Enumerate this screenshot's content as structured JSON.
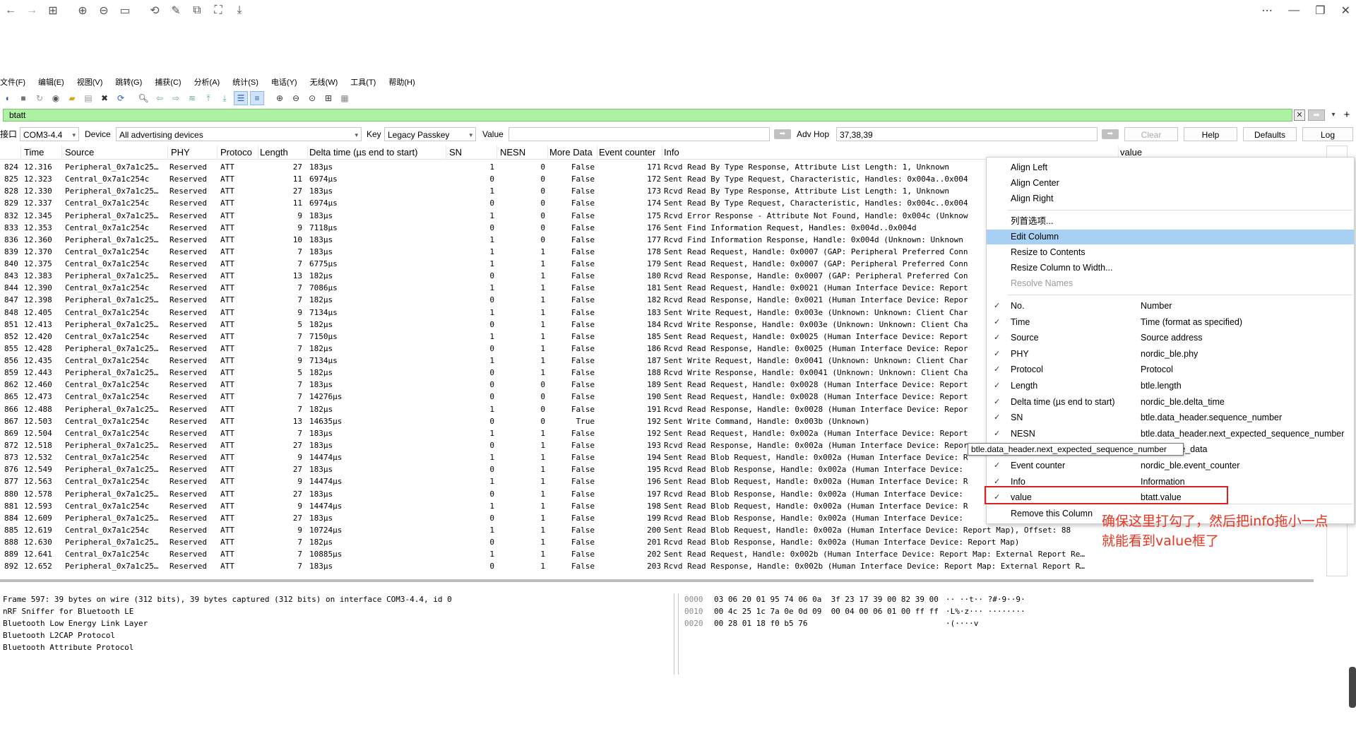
{
  "topbar": {
    "icons": [
      "back-icon",
      "forward-icon",
      "grid-icon",
      "zoom-in-icon",
      "zoom-out-icon",
      "fit-icon",
      "rotate-icon",
      "edit-icon",
      "copy-icon",
      "screenshot-icon",
      "save-icon"
    ],
    "window_controls": [
      "more-icon",
      "minimize-icon",
      "restore-icon",
      "close-icon"
    ]
  },
  "menubar": {
    "items": [
      "文件(F)",
      "编辑(E)",
      "视图(V)",
      "跳转(G)",
      "捕获(C)",
      "分析(A)",
      "统计(S)",
      "电话(Y)",
      "无线(W)",
      "工具(T)",
      "帮助(H)"
    ]
  },
  "filter": {
    "value": "btatt"
  },
  "sniffer": {
    "interface_label": "接口",
    "interface_value": "COM3-4.4",
    "device_label": "Device",
    "device_value": "All advertising devices",
    "key_label": "Key",
    "key_value": "Legacy Passkey",
    "value_label": "Value",
    "value_value": "",
    "advhop_label": "Adv Hop",
    "advhop_value": "37,38,39",
    "clear_label": "Clear",
    "help_label": "Help",
    "defaults_label": "Defaults",
    "log_label": "Log"
  },
  "packet_list": {
    "headers": {
      "time": "Time",
      "source": "Source",
      "phy": "PHY",
      "protocol": "Protoco",
      "length": "Length",
      "delta": "Delta time (µs end to start)",
      "sn": "SN",
      "nesn": "NESN",
      "more": "More Data",
      "event": "Event counter",
      "info": "Info",
      "value": "value"
    },
    "rows": [
      {
        "no": "824",
        "time": "12.316",
        "source": "Peripheral_0x7a1c25…",
        "phy": "Reserved",
        "proto": "ATT",
        "len": "27",
        "delta": "183µs",
        "sn": "1",
        "nesn": "0",
        "more": "False",
        "ev": "171",
        "info": "Rcvd Read By Type Response, Attribute List Length: 1, Unknown"
      },
      {
        "no": "825",
        "time": "12.323",
        "source": "Central_0x7a1c254c",
        "phy": "Reserved",
        "proto": "ATT",
        "len": "11",
        "delta": "6974µs",
        "sn": "0",
        "nesn": "0",
        "more": "False",
        "ev": "172",
        "info": "Sent Read By Type Request, Characteristic, Handles: 0x004a..0x004"
      },
      {
        "no": "828",
        "time": "12.330",
        "source": "Peripheral_0x7a1c25…",
        "phy": "Reserved",
        "proto": "ATT",
        "len": "27",
        "delta": "183µs",
        "sn": "1",
        "nesn": "0",
        "more": "False",
        "ev": "173",
        "info": "Rcvd Read By Type Response, Attribute List Length: 1, Unknown"
      },
      {
        "no": "829",
        "time": "12.337",
        "source": "Central_0x7a1c254c",
        "phy": "Reserved",
        "proto": "ATT",
        "len": "11",
        "delta": "6974µs",
        "sn": "0",
        "nesn": "0",
        "more": "False",
        "ev": "174",
        "info": "Sent Read By Type Request, Characteristic, Handles: 0x004c..0x004"
      },
      {
        "no": "832",
        "time": "12.345",
        "source": "Peripheral_0x7a1c25…",
        "phy": "Reserved",
        "proto": "ATT",
        "len": "9",
        "delta": "183µs",
        "sn": "1",
        "nesn": "0",
        "more": "False",
        "ev": "175",
        "info": "Rcvd Error Response - Attribute Not Found, Handle: 0x004c (Unknow"
      },
      {
        "no": "833",
        "time": "12.353",
        "source": "Central_0x7a1c254c",
        "phy": "Reserved",
        "proto": "ATT",
        "len": "9",
        "delta": "7118µs",
        "sn": "0",
        "nesn": "0",
        "more": "False",
        "ev": "176",
        "info": "Sent Find Information Request, Handles: 0x004d..0x004d"
      },
      {
        "no": "836",
        "time": "12.360",
        "source": "Peripheral_0x7a1c25…",
        "phy": "Reserved",
        "proto": "ATT",
        "len": "10",
        "delta": "183µs",
        "sn": "1",
        "nesn": "0",
        "more": "False",
        "ev": "177",
        "info": "Rcvd Find Information Response, Handle: 0x004d (Unknown: Unknown"
      },
      {
        "no": "839",
        "time": "12.370",
        "source": "Central_0x7a1c254c",
        "phy": "Reserved",
        "proto": "ATT",
        "len": "7",
        "delta": "183µs",
        "sn": "1",
        "nesn": "1",
        "more": "False",
        "ev": "178",
        "info": "Sent Read Request, Handle: 0x0007 (GAP: Peripheral Preferred Conn"
      },
      {
        "no": "840",
        "time": "12.375",
        "source": "Central_0x7a1c254c",
        "phy": "Reserved",
        "proto": "ATT",
        "len": "7",
        "delta": "6775µs",
        "sn": "1",
        "nesn": "1",
        "more": "False",
        "ev": "179",
        "info": "Sent Read Request, Handle: 0x0007 (GAP: Peripheral Preferred Conn"
      },
      {
        "no": "843",
        "time": "12.383",
        "source": "Peripheral_0x7a1c25…",
        "phy": "Reserved",
        "proto": "ATT",
        "len": "13",
        "delta": "182µs",
        "sn": "0",
        "nesn": "1",
        "more": "False",
        "ev": "180",
        "info": "Rcvd Read Response, Handle: 0x0007 (GAP: Peripheral Preferred Con"
      },
      {
        "no": "844",
        "time": "12.390",
        "source": "Central_0x7a1c254c",
        "phy": "Reserved",
        "proto": "ATT",
        "len": "7",
        "delta": "7086µs",
        "sn": "1",
        "nesn": "1",
        "more": "False",
        "ev": "181",
        "info": "Sent Read Request, Handle: 0x0021 (Human Interface Device: Report"
      },
      {
        "no": "847",
        "time": "12.398",
        "source": "Peripheral_0x7a1c25…",
        "phy": "Reserved",
        "proto": "ATT",
        "len": "7",
        "delta": "182µs",
        "sn": "0",
        "nesn": "1",
        "more": "False",
        "ev": "182",
        "info": "Rcvd Read Response, Handle: 0x0021 (Human Interface Device: Repor"
      },
      {
        "no": "848",
        "time": "12.405",
        "source": "Central_0x7a1c254c",
        "phy": "Reserved",
        "proto": "ATT",
        "len": "9",
        "delta": "7134µs",
        "sn": "1",
        "nesn": "1",
        "more": "False",
        "ev": "183",
        "info": "Sent Write Request, Handle: 0x003e (Unknown: Unknown: Client Char"
      },
      {
        "no": "851",
        "time": "12.413",
        "source": "Peripheral_0x7a1c25…",
        "phy": "Reserved",
        "proto": "ATT",
        "len": "5",
        "delta": "182µs",
        "sn": "0",
        "nesn": "1",
        "more": "False",
        "ev": "184",
        "info": "Rcvd Write Response, Handle: 0x003e (Unknown: Unknown: Client Cha"
      },
      {
        "no": "852",
        "time": "12.420",
        "source": "Central_0x7a1c254c",
        "phy": "Reserved",
        "proto": "ATT",
        "len": "7",
        "delta": "7150µs",
        "sn": "1",
        "nesn": "1",
        "more": "False",
        "ev": "185",
        "info": "Sent Read Request, Handle: 0x0025 (Human Interface Device: Report"
      },
      {
        "no": "855",
        "time": "12.428",
        "source": "Peripheral_0x7a1c25…",
        "phy": "Reserved",
        "proto": "ATT",
        "len": "7",
        "delta": "182µs",
        "sn": "0",
        "nesn": "1",
        "more": "False",
        "ev": "186",
        "info": "Rcvd Read Response, Handle: 0x0025 (Human Interface Device: Repor"
      },
      {
        "no": "856",
        "time": "12.435",
        "source": "Central_0x7a1c254c",
        "phy": "Reserved",
        "proto": "ATT",
        "len": "9",
        "delta": "7134µs",
        "sn": "1",
        "nesn": "1",
        "more": "False",
        "ev": "187",
        "info": "Sent Write Request, Handle: 0x0041 (Unknown: Unknown: Client Char"
      },
      {
        "no": "859",
        "time": "12.443",
        "source": "Peripheral_0x7a1c25…",
        "phy": "Reserved",
        "proto": "ATT",
        "len": "5",
        "delta": "182µs",
        "sn": "0",
        "nesn": "1",
        "more": "False",
        "ev": "188",
        "info": "Rcvd Write Response, Handle: 0x0041 (Unknown: Unknown: Client Cha"
      },
      {
        "no": "862",
        "time": "12.460",
        "source": "Central_0x7a1c254c",
        "phy": "Reserved",
        "proto": "ATT",
        "len": "7",
        "delta": "183µs",
        "sn": "0",
        "nesn": "0",
        "more": "False",
        "ev": "189",
        "info": "Sent Read Request, Handle: 0x0028 (Human Interface Device: Report"
      },
      {
        "no": "865",
        "time": "12.473",
        "source": "Central_0x7a1c254c",
        "phy": "Reserved",
        "proto": "ATT",
        "len": "7",
        "delta": "14276µs",
        "sn": "0",
        "nesn": "0",
        "more": "False",
        "ev": "190",
        "info": "Sent Read Request, Handle: 0x0028 (Human Interface Device: Report"
      },
      {
        "no": "866",
        "time": "12.488",
        "source": "Peripheral_0x7a1c25…",
        "phy": "Reserved",
        "proto": "ATT",
        "len": "7",
        "delta": "182µs",
        "sn": "1",
        "nesn": "0",
        "more": "False",
        "ev": "191",
        "info": "Rcvd Read Response, Handle: 0x0028 (Human Interface Device: Repor"
      },
      {
        "no": "867",
        "time": "12.503",
        "source": "Central_0x7a1c254c",
        "phy": "Reserved",
        "proto": "ATT",
        "len": "13",
        "delta": "14635µs",
        "sn": "0",
        "nesn": "0",
        "more": "True",
        "ev": "192",
        "info": "Sent Write Command, Handle: 0x003b (Unknown)"
      },
      {
        "no": "869",
        "time": "12.504",
        "source": "Central_0x7a1c254c",
        "phy": "Reserved",
        "proto": "ATT",
        "len": "7",
        "delta": "183µs",
        "sn": "1",
        "nesn": "1",
        "more": "False",
        "ev": "192",
        "info": "Sent Read Request, Handle: 0x002a (Human Interface Device: Report"
      },
      {
        "no": "872",
        "time": "12.518",
        "source": "Peripheral_0x7a1c25…",
        "phy": "Reserved",
        "proto": "ATT",
        "len": "27",
        "delta": "183µs",
        "sn": "0",
        "nesn": "1",
        "more": "False",
        "ev": "193",
        "info": "Rcvd Read Response, Handle: 0x002a (Human Interface Device: Repor"
      },
      {
        "no": "873",
        "time": "12.532",
        "source": "Central_0x7a1c254c",
        "phy": "Reserved",
        "proto": "ATT",
        "len": "9",
        "delta": "14474µs",
        "sn": "1",
        "nesn": "1",
        "more": "False",
        "ev": "194",
        "info": "Sent Read Blob Request, Handle: 0x002a (Human Interface Device: R"
      },
      {
        "no": "876",
        "time": "12.549",
        "source": "Peripheral_0x7a1c25…",
        "phy": "Reserved",
        "proto": "ATT",
        "len": "27",
        "delta": "183µs",
        "sn": "0",
        "nesn": "1",
        "more": "False",
        "ev": "195",
        "info": "Rcvd Read Blob Response, Handle: 0x002a (Human Interface Device: "
      },
      {
        "no": "877",
        "time": "12.563",
        "source": "Central_0x7a1c254c",
        "phy": "Reserved",
        "proto": "ATT",
        "len": "9",
        "delta": "14474µs",
        "sn": "1",
        "nesn": "1",
        "more": "False",
        "ev": "196",
        "info": "Sent Read Blob Request, Handle: 0x002a (Human Interface Device: R"
      },
      {
        "no": "880",
        "time": "12.578",
        "source": "Peripheral_0x7a1c25…",
        "phy": "Reserved",
        "proto": "ATT",
        "len": "27",
        "delta": "183µs",
        "sn": "0",
        "nesn": "1",
        "more": "False",
        "ev": "197",
        "info": "Rcvd Read Blob Response, Handle: 0x002a (Human Interface Device: "
      },
      {
        "no": "881",
        "time": "12.593",
        "source": "Central_0x7a1c254c",
        "phy": "Reserved",
        "proto": "ATT",
        "len": "9",
        "delta": "14474µs",
        "sn": "1",
        "nesn": "1",
        "more": "False",
        "ev": "198",
        "info": "Sent Read Blob Request, Handle: 0x002a (Human Interface Device: R"
      },
      {
        "no": "884",
        "time": "12.609",
        "source": "Peripheral_0x7a1c25…",
        "phy": "Reserved",
        "proto": "ATT",
        "len": "27",
        "delta": "183µs",
        "sn": "0",
        "nesn": "1",
        "more": "False",
        "ev": "199",
        "info": "Rcvd Read Blob Response, Handle: 0x002a (Human Interface Device: "
      },
      {
        "no": "885",
        "time": "12.619",
        "source": "Central_0x7a1c254c",
        "phy": "Reserved",
        "proto": "ATT",
        "len": "9",
        "delta": "10724µs",
        "sn": "1",
        "nesn": "1",
        "more": "False",
        "ev": "200",
        "info": "Sent Read Blob Request, Handle: 0x002a (Human Interface Device: Report Map), Offset: 88"
      },
      {
        "no": "888",
        "time": "12.630",
        "source": "Peripheral_0x7a1c25…",
        "phy": "Reserved",
        "proto": "ATT",
        "len": "7",
        "delta": "182µs",
        "sn": "0",
        "nesn": "1",
        "more": "False",
        "ev": "201",
        "info": "Rcvd Read Blob Response, Handle: 0x002a (Human Interface Device: Report Map)"
      },
      {
        "no": "889",
        "time": "12.641",
        "source": "Central_0x7a1c254c",
        "phy": "Reserved",
        "proto": "ATT",
        "len": "7",
        "delta": "10885µs",
        "sn": "1",
        "nesn": "1",
        "more": "False",
        "ev": "202",
        "info": "Sent Read Request, Handle: 0x002b (Human Interface Device: Report Map: External Report Re…"
      },
      {
        "no": "892",
        "time": "12.652",
        "source": "Peripheral_0x7a1c25…",
        "phy": "Reserved",
        "proto": "ATT",
        "len": "7",
        "delta": "183µs",
        "sn": "0",
        "nesn": "1",
        "more": "False",
        "ev": "203",
        "info": "Rcvd Read Response, Handle: 0x002b (Human Interface Device: Report Map: External Report R…"
      }
    ]
  },
  "detail": {
    "lines": [
      "Frame 597: 39 bytes on wire (312 bits), 39 bytes captured (312 bits) on interface COM3-4.4, id 0",
      "nRF Sniffer for Bluetooth LE",
      "Bluetooth Low Energy Link Layer",
      "Bluetooth L2CAP Protocol",
      "Bluetooth Attribute Protocol"
    ]
  },
  "bytes": {
    "lines": [
      {
        "offset": "0000",
        "hex": "03 06 20 01 95 74 06 0a  3f 23 17 39 00 82 39 00",
        "ascii": "·· ··t·· ?#·9··9·"
      },
      {
        "offset": "0010",
        "hex": "00 4c 25 1c 7a 0e 0d 09  00 04 00 06 01 00 ff ff",
        "ascii": "·L%·z··· ········"
      },
      {
        "offset": "0020",
        "hex": "00 28 01 18 f0 b5 76",
        "ascii": "·(····v"
      }
    ]
  },
  "context_menu": {
    "align_left": "Align Left",
    "align_center": "Align Center",
    "align_right": "Align Right",
    "column_prefs": "列首选项...",
    "edit_column": "Edit Column",
    "resize_to_contents": "Resize to Contents",
    "resize_to_width": "Resize Column to Width...",
    "resolve_names": "Resolve Names",
    "columns": [
      {
        "name": "No.",
        "field": "Number",
        "checked": true
      },
      {
        "name": "Time",
        "field": "Time (format as specified)",
        "checked": true
      },
      {
        "name": "Source",
        "field": "Source address",
        "checked": true
      },
      {
        "name": "PHY",
        "field": "nordic_ble.phy",
        "checked": true
      },
      {
        "name": "Protocol",
        "field": "Protocol",
        "checked": true
      },
      {
        "name": "Length",
        "field": "btle.length",
        "checked": true
      },
      {
        "name": "Delta time (µs end to start)",
        "field": "nordic_ble.delta_time",
        "checked": true
      },
      {
        "name": "SN",
        "field": "btle.data_header.sequence_number",
        "checked": true
      },
      {
        "name": "NESN",
        "field": "btle.data_header.next_expected_sequence_number",
        "checked": true
      },
      {
        "name": "",
        "field": "eader.more_data",
        "checked": false
      },
      {
        "name": "Event counter",
        "field": "nordic_ble.event_counter",
        "checked": true
      },
      {
        "name": "Info",
        "field": "Information",
        "checked": true
      },
      {
        "name": "value",
        "field": "btatt.value",
        "checked": true
      }
    ],
    "remove_column": "Remove this Column",
    "tooltip": "btle.data_header.next_expected_sequence_number"
  },
  "annotation": {
    "line1": "确保这里打勾了，然后把info拖小一点",
    "line2": "就能看到value框了"
  },
  "colors": {
    "filter_bg": "#aef0a4",
    "menu_highlight": "#a8d0f5",
    "annotation": "#e8331f"
  }
}
